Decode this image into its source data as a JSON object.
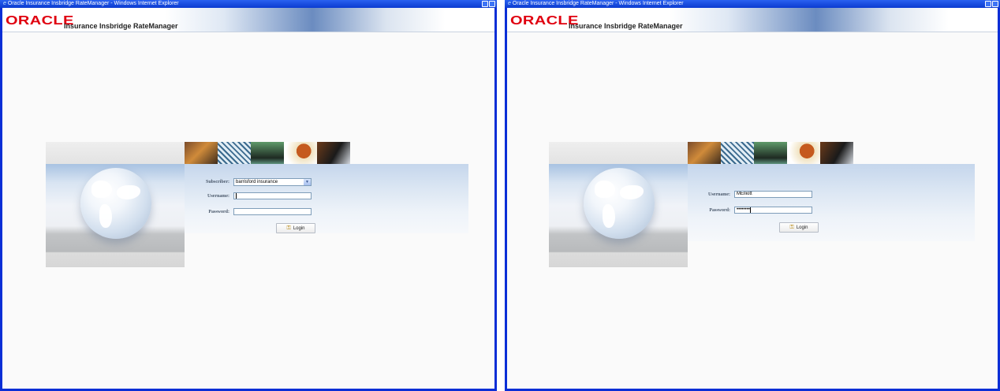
{
  "windows": [
    {
      "title": "Oracle Insurance Insbridge RateManager - Windows Internet Explorer",
      "brand": {
        "logo": "ORACLE",
        "product": "Insurance Insbridge RateManager"
      },
      "form": {
        "subscriber_label": "Subscriber:",
        "subscriber_value": "barrisford insurance",
        "username_label": "Username:",
        "username_value": "",
        "password_label": "Password:",
        "password_value": "",
        "login_label": "Login"
      }
    },
    {
      "title": "Oracle Insurance Insbridge RateManager - Windows Internet Explorer",
      "brand": {
        "logo": "ORACLE",
        "product": "Insurance Insbridge RateManager"
      },
      "form": {
        "username_label": "Username:",
        "username_value": "MElliott",
        "password_label": "Password:",
        "password_value": "••••••••",
        "login_label": "Login"
      }
    }
  ],
  "icons": {
    "browser": "ie-icon",
    "titlebar_buttons": [
      "minimize-icon",
      "restore-icon"
    ],
    "login": "key-icon"
  },
  "colors": {
    "titlebar": "#0b3bd0",
    "oracle_red": "#e0000f",
    "field_border": "#7f9db9",
    "label": "#4c5a6c"
  }
}
